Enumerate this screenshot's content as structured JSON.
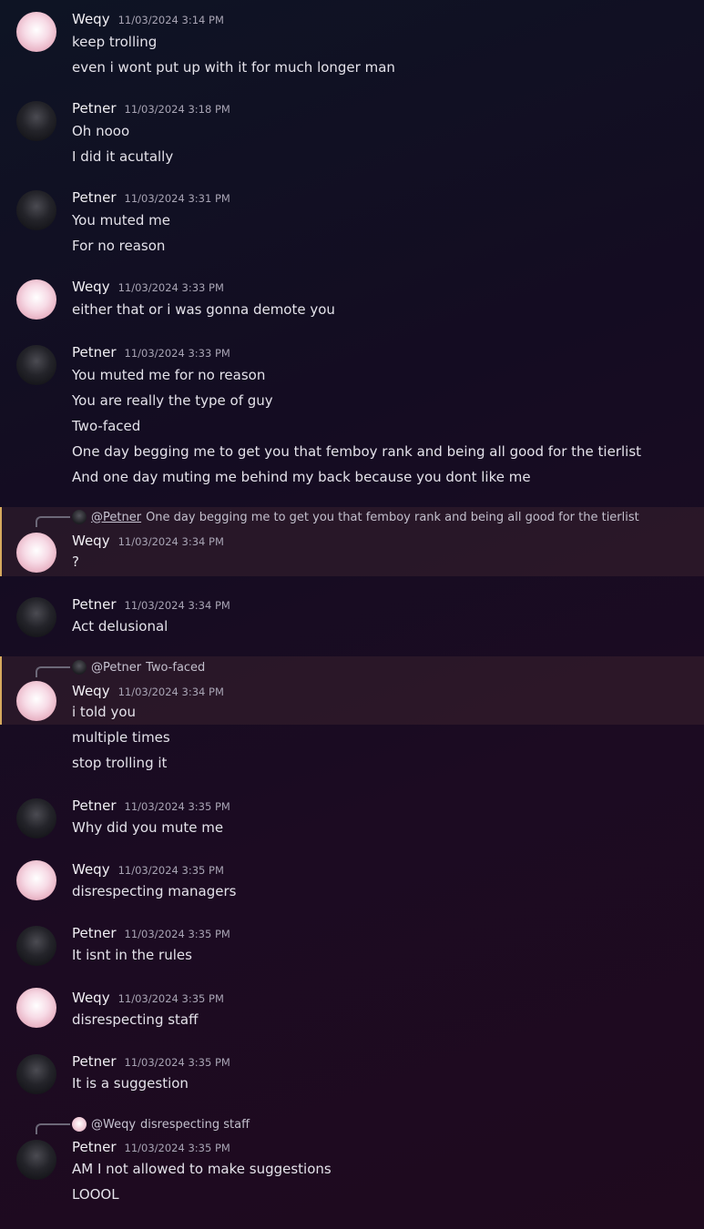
{
  "users": {
    "weqy": "Weqy",
    "petner": "Petner"
  },
  "messages": [
    {
      "author": "Weqy",
      "timestamp": "11/03/2024 3:14 PM",
      "lines": [
        "keep trolling",
        "even i wont put up with it for much longer man"
      ]
    },
    {
      "author": "Petner",
      "timestamp": "11/03/2024 3:18 PM",
      "lines": [
        "Oh nooo",
        "I did it acutally"
      ]
    },
    {
      "author": "Petner",
      "timestamp": "11/03/2024 3:31 PM",
      "lines": [
        "You muted me",
        "For no reason"
      ]
    },
    {
      "author": "Weqy",
      "timestamp": "11/03/2024 3:33 PM",
      "lines": [
        "either that or i was gonna demote you"
      ]
    },
    {
      "author": "Petner",
      "timestamp": "11/03/2024 3:33 PM",
      "lines": [
        "You muted me for no reason",
        "You are really the type of guy",
        "Two-faced",
        "One day begging me to get you that femboy rank and being all good for the tierlist",
        "And one day muting me behind my back because you dont like me"
      ]
    },
    {
      "author": "Weqy",
      "timestamp": "11/03/2024 3:34 PM",
      "highlighted": true,
      "reply": {
        "user": "@Petner",
        "text": "One day begging me to get you that femboy rank and being all good for the tierlist"
      },
      "lines": [
        "?"
      ]
    },
    {
      "author": "Petner",
      "timestamp": "11/03/2024 3:34 PM",
      "lines": [
        "Act delusional"
      ]
    },
    {
      "author": "Weqy",
      "timestamp": "11/03/2024 3:34 PM",
      "highlighted": true,
      "reply": {
        "user": "@Petner",
        "text": "Two-faced"
      },
      "lines": [
        "i told you",
        "multiple times",
        "stop trolling it"
      ]
    },
    {
      "author": "Petner",
      "timestamp": "11/03/2024 3:35 PM",
      "lines": [
        "Why did you mute me"
      ]
    },
    {
      "author": "Weqy",
      "timestamp": "11/03/2024 3:35 PM",
      "lines": [
        "disrespecting managers"
      ]
    },
    {
      "author": "Petner",
      "timestamp": "11/03/2024 3:35 PM",
      "lines": [
        "It isnt in the rules"
      ]
    },
    {
      "author": "Weqy",
      "timestamp": "11/03/2024 3:35 PM",
      "lines": [
        "disrespecting staff"
      ]
    },
    {
      "author": "Petner",
      "timestamp": "11/03/2024 3:35 PM",
      "lines": [
        "It is a suggestion"
      ]
    },
    {
      "author": "Petner",
      "timestamp": "11/03/2024 3:35 PM",
      "reply": {
        "user": "@Weqy",
        "text": "disrespecting staff"
      },
      "lines": [
        "AM I not allowed to make suggestions",
        "LOOOL"
      ]
    }
  ],
  "colors": {
    "mention_accent": "#d6a95e",
    "username": "#f2f0f5",
    "timestamp": "#a8a4b4",
    "message_text": "#e4e2ea"
  },
  "icons": {
    "weqy_avatar": "white-cat-avatar-icon",
    "petner_avatar": "dark-portrait-avatar-icon",
    "reply_spine": "reply-arrow-icon"
  }
}
